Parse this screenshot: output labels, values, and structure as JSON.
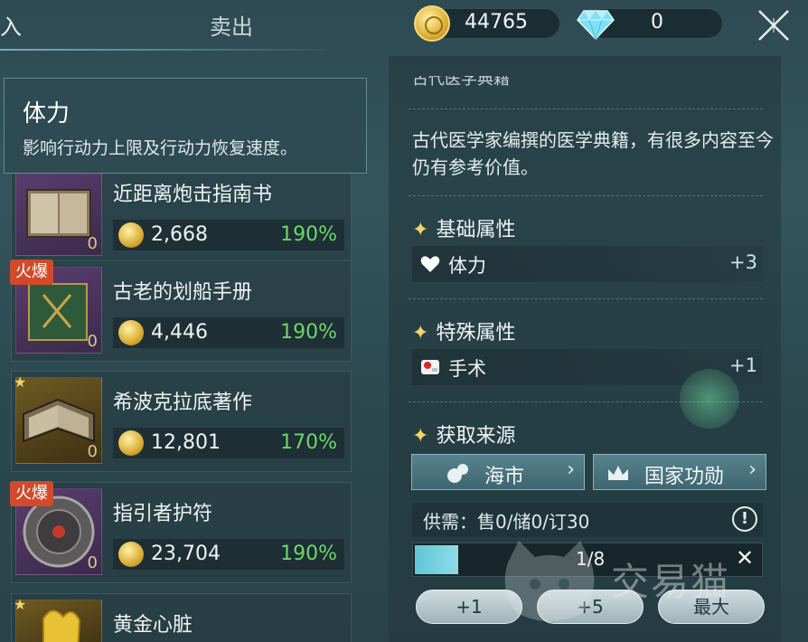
{
  "tabs": {
    "buy": "入",
    "sell": "卖出"
  },
  "currency": {
    "coins": "44765",
    "gems": "0"
  },
  "tooltip": {
    "title": "体力",
    "description": "影响行动力上限及行动力恢复速度。"
  },
  "items": [
    {
      "name": "近距离炮击指南书",
      "price": "2,668",
      "percent": "190%",
      "count": "0",
      "badge": "",
      "star": false,
      "rarity": "purple"
    },
    {
      "name": "古老的划船手册",
      "price": "4,446",
      "percent": "190%",
      "count": "0",
      "badge": "火爆",
      "star": false,
      "rarity": "purple"
    },
    {
      "name": "希波克拉底著作",
      "price": "12,801",
      "percent": "170%",
      "count": "0",
      "badge": "",
      "star": true,
      "rarity": "gold"
    },
    {
      "name": "指引者护符",
      "price": "23,704",
      "percent": "190%",
      "count": "0",
      "badge": "火爆",
      "star": false,
      "rarity": "purple"
    },
    {
      "name": "黄金心脏",
      "price": "",
      "percent": "",
      "count": "",
      "badge": "",
      "star": true,
      "rarity": "gold"
    }
  ],
  "detail": {
    "cut_title": "古代医学典籍",
    "description": "古代医学家编撰的医学典籍，有很多内容至今仍有参考价值。",
    "base_attr_title": "基础属性",
    "base_attr": {
      "label": "体力",
      "value": "+3",
      "icon": "heart-icon"
    },
    "special_attr_title": "特殊属性",
    "special_attr": {
      "label": "手术",
      "value": "+1",
      "icon": "surgery-icon"
    },
    "source_title": "获取来源",
    "sources": [
      {
        "label": "海市",
        "icon": "market-icon"
      },
      {
        "label": "国家功勋",
        "icon": "crown-icon"
      }
    ],
    "supply": "供需：售0/储0/订30",
    "quantity": {
      "text": "1/8",
      "fraction": 0.125
    },
    "steps": [
      "+1",
      "+5",
      "最大"
    ]
  },
  "watermark": "交易猫",
  "colors": {
    "accent_green": "#6ed66a",
    "hot_badge": "#d24a2a",
    "gold": "#f3d46a"
  }
}
